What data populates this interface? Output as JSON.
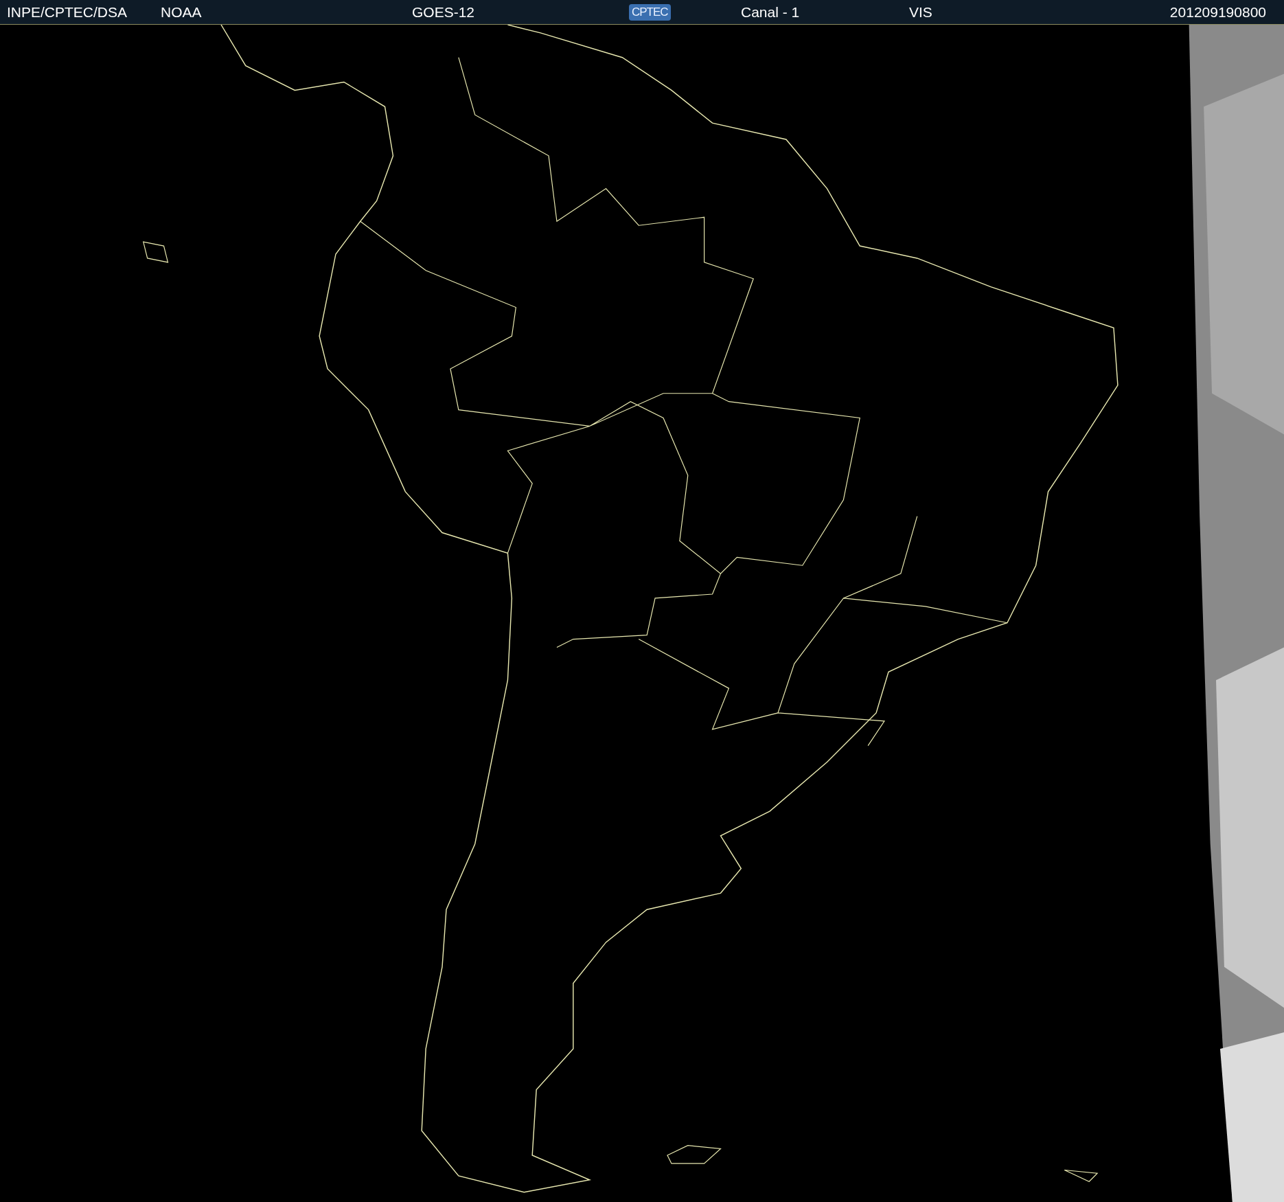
{
  "header": {
    "source": "INPE/CPTEC/DSA",
    "agency": "NOAA",
    "satellite": "GOES-12",
    "logo": "CPTEC",
    "channel": "Canal - 1",
    "band": "VIS",
    "timestamp": "201209190800"
  }
}
